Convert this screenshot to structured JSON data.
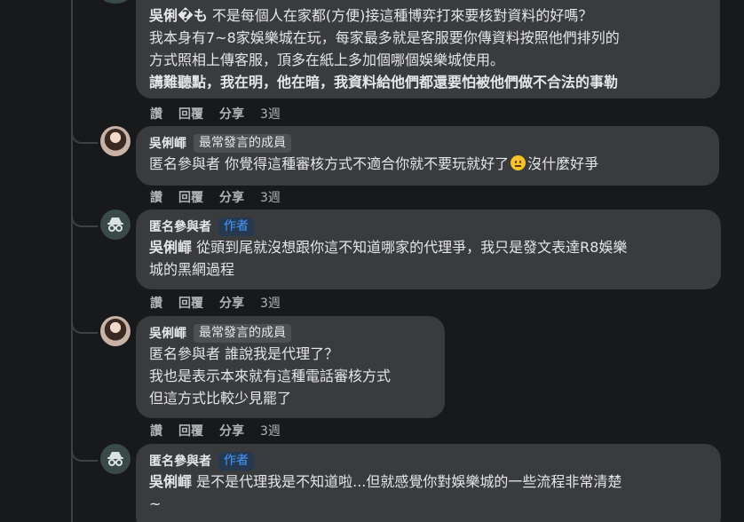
{
  "comments": [
    {
      "lines": [
        [
          "吳俐�も",
          " 不是每個人在家都(方便)接這種博弈打來要核對資料的好嗎？"
        ],
        [
          "",
          "我本身有7~8家娛樂城在玩，每家最多就是客服要你傳資料按照他們排列的"
        ],
        [
          "",
          "方式照相上傳客服，頂多在紙上多加個哪個娛樂城使用。"
        ],
        [
          "",
          "講難聽點，我在明，他在暗，我資料給他們都還要怕被他們做不合法的事勒"
        ]
      ],
      "actions": {
        "like": "讚",
        "reply": "回覆",
        "share": "分享",
        "time": "3週"
      }
    },
    {
      "author": "吳俐嶵",
      "badge": "最常發言的成員",
      "text_before": "匿名參與者 你覺得這種審核方式不適合你就不要玩就好了",
      "emoji": "neutral-face-emoji",
      "text_after": "沒什麼好爭",
      "actions": {
        "like": "讚",
        "reply": "回覆",
        "share": "分享",
        "time": "3週"
      }
    },
    {
      "author": "匿名參與者",
      "badge": "作者",
      "mention": "吳俐嶵",
      "line1": " 從頭到尾就沒想跟你這不知道哪家的代理爭，我只是發文表達R8娛樂",
      "line2": "城的黑網過程",
      "actions": {
        "like": "讚",
        "reply": "回覆",
        "share": "分享",
        "time": "3週"
      }
    },
    {
      "author": "吳俐嶵",
      "badge": "最常發言的成員",
      "line1": "匿名參與者 誰說我是代理了？",
      "line2": "我也是表示本來就有這種電話審核方式",
      "line3": "但這方式比較少見罷了",
      "actions": {
        "like": "讚",
        "reply": "回覆",
        "share": "分享",
        "time": "3週"
      }
    },
    {
      "author": "匿名參與者",
      "badge": "作者",
      "mention": "吳俐嶵",
      "line1": " 是不是代理我是不知道啦...但就感覺你對娛樂城的一些流程非常清楚",
      "line2": "~"
    }
  ]
}
